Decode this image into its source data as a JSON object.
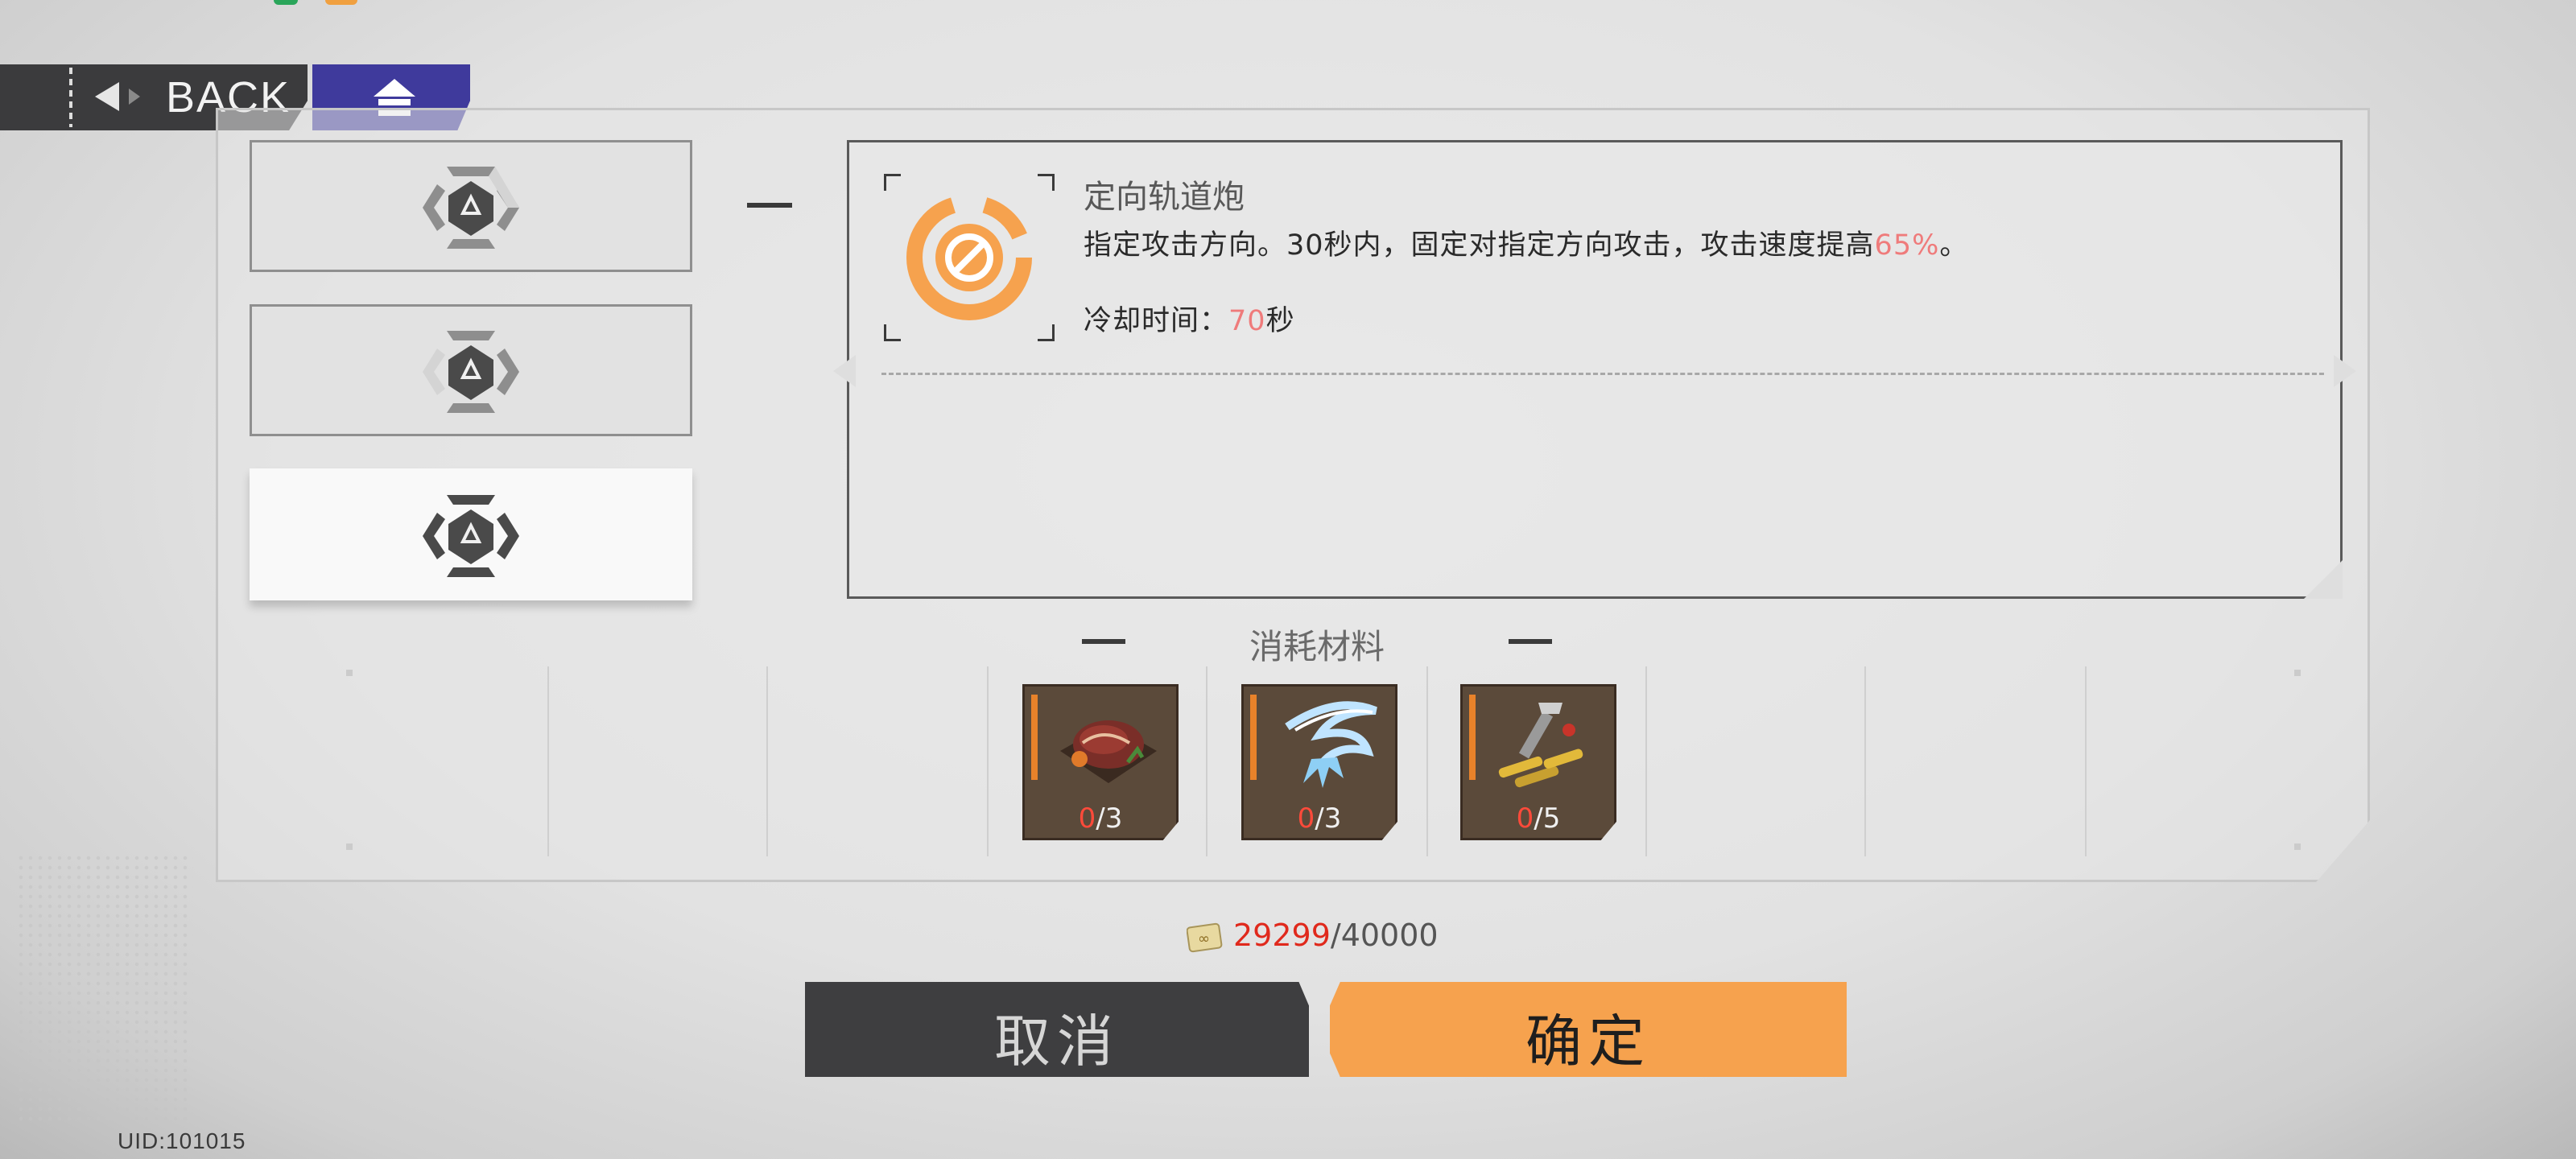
{
  "nav": {
    "back_label": "BACK",
    "home_icon": "home-icon"
  },
  "skill": {
    "title": "定向轨道炮",
    "desc_prefix": "指定攻击方向。30秒内，固定对指定方向攻击，攻击速度提高",
    "desc_value": "65%",
    "desc_suffix": "。",
    "cooldown_label": "冷却时间：",
    "cooldown_value": "70",
    "cooldown_unit": "秒",
    "accent": "#f6a24e",
    "highlight": "#ef7b7b"
  },
  "materials": {
    "title": "消耗材料",
    "items": [
      {
        "icon": "steak-icon",
        "have": "0",
        "need": "/3"
      },
      {
        "icon": "ice-blade-icon",
        "have": "0",
        "need": "/3"
      },
      {
        "icon": "ammo-tool-icon",
        "have": "0",
        "need": "/5"
      }
    ]
  },
  "currency": {
    "icon": "coin-icon",
    "have": "29299",
    "need": "/40000"
  },
  "buttons": {
    "cancel": "取消",
    "confirm": "确定"
  },
  "uid": "UID:101015",
  "colors": {
    "back_bg": "#3b3b3d",
    "home_bg": "#3f3a9c",
    "confirm_bg": "#f6a24e",
    "cancel_bg": "#3e3e40",
    "insufficient": "#e0291c"
  }
}
